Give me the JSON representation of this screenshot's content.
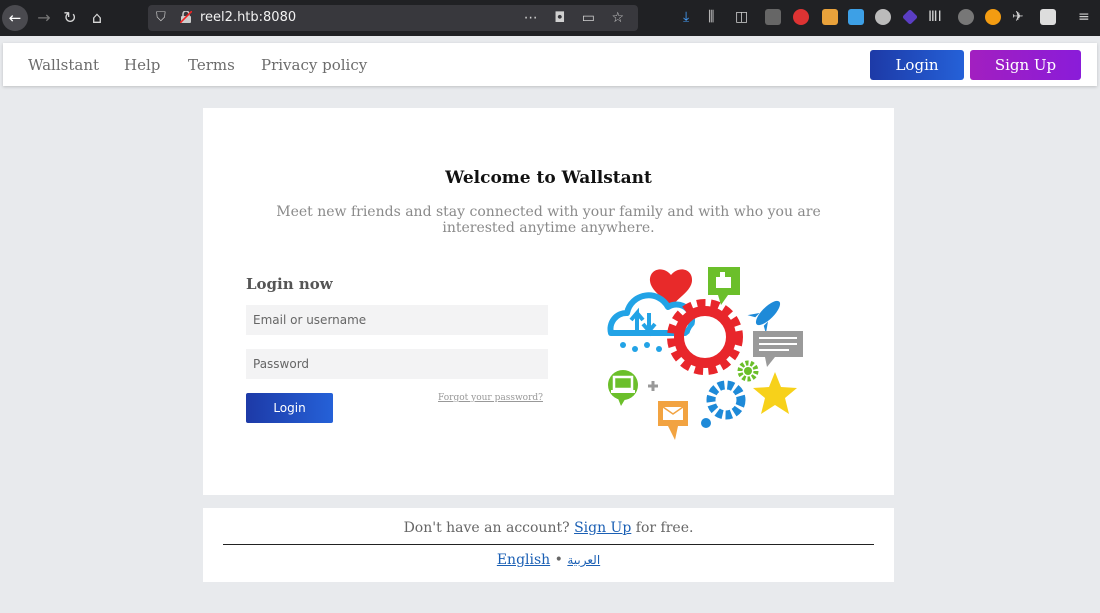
{
  "browser": {
    "url": "reel2.htb:8080",
    "accent": "#202124"
  },
  "navbar": {
    "links": [
      "Wallstant",
      "Help",
      "Terms",
      "Privacy policy"
    ],
    "login_label": "Login",
    "signup_label": "Sign Up"
  },
  "main": {
    "welcome": "Welcome to Wallstant",
    "tagline": "Meet new friends and stay connected with your family and with who you are interested anytime anywhere.",
    "login_heading": "Login now",
    "username_placeholder": "Email or username",
    "password_placeholder": "Password",
    "login_button": "Login",
    "forgot_link": "Forgot your password?"
  },
  "footer": {
    "no_account": "Don't have an account?",
    "signup_link": "Sign Up",
    "for_free": "for free.",
    "lang_english": "English",
    "lang_separator": "•",
    "lang_arabic": "العربية"
  },
  "colors": {
    "primary_blue": "#2561d8",
    "signup_purple": "#a21fc0",
    "page_bg": "#e8eaed"
  }
}
